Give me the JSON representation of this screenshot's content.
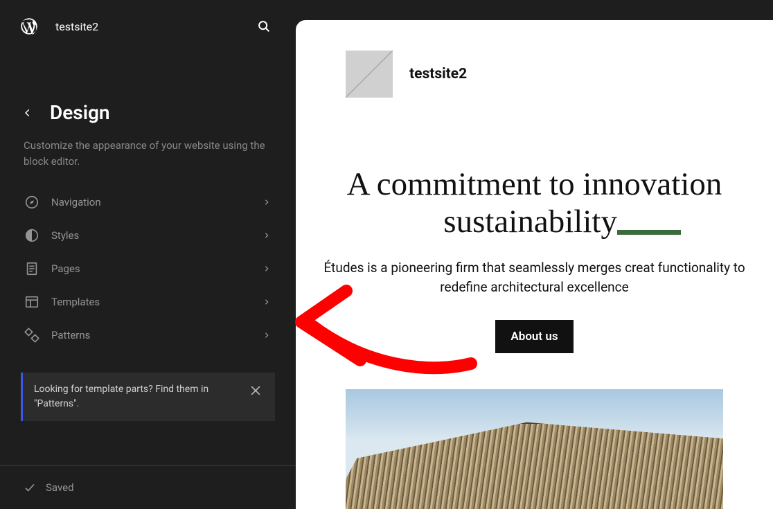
{
  "topbar": {
    "site_name": "testsite2"
  },
  "panel": {
    "title": "Design",
    "description": "Customize the appearance of your website using the block editor."
  },
  "nav": [
    {
      "icon": "compass-icon",
      "label": "Navigation"
    },
    {
      "icon": "half-circle-icon",
      "label": "Styles"
    },
    {
      "icon": "page-icon",
      "label": "Pages"
    },
    {
      "icon": "layout-icon",
      "label": "Templates"
    },
    {
      "icon": "patterns-icon",
      "label": "Patterns"
    }
  ],
  "notice": {
    "text": "Looking for template parts? Find them in \"Patterns\"."
  },
  "saved": {
    "label": "Saved"
  },
  "preview": {
    "site_name": "testsite2",
    "hero_line1": "A commitment to innovation",
    "hero_line2": "sustainability",
    "hero_text": "Études is a pioneering firm that seamlessly merges creat functionality to redefine architectural excellence",
    "cta_label": "About us"
  }
}
